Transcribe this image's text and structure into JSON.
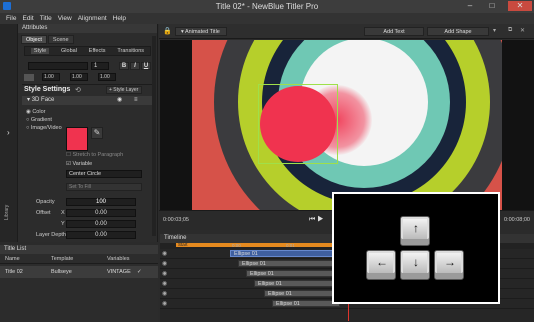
{
  "app": {
    "title": "Title 02* - NewBlue Titler Pro",
    "win_min": "–",
    "win_max": "□",
    "win_close": "✕"
  },
  "menu": [
    "File",
    "Edit",
    "Title",
    "View",
    "Alignment",
    "Help"
  ],
  "rail": {
    "label": "Library"
  },
  "attributes": {
    "header": "Attributes",
    "tabs": [
      "Object",
      "Scene"
    ],
    "subtabs": [
      "Style",
      "Global",
      "Effects",
      "Transitions"
    ],
    "font_size": "1",
    "bold": "B",
    "italic": "I",
    "underline": "U",
    "num1": "1.00",
    "num2": "1.00",
    "num3": "1.00",
    "style_settings": "Style Settings",
    "style_layer": "+ Style Layer",
    "face": "3D Face",
    "fill_types": [
      "Color",
      "Gradient",
      "Image/Video"
    ],
    "stretch": "Stretch to Paragraph",
    "variable": "Variable",
    "variable_value": "Center Circle",
    "set_to_fill": "Set To Fill",
    "opacity_label": "Opacity",
    "opacity_value": "100",
    "offset_label": "Offset",
    "x_label": "X",
    "x_value": "0.00",
    "y_label": "Y",
    "y_value": "0.00",
    "layer_depth_label": "Layer Depth",
    "layer_depth_value": "0.00",
    "swatch_color": "#f0334f"
  },
  "title_list": {
    "header": "Title List",
    "columns": [
      "Name",
      "Template",
      "Variables"
    ],
    "rows": [
      {
        "name": "Title 02",
        "template": "Bullseye",
        "variables": "VINTAGE"
      }
    ]
  },
  "toolbar": {
    "title_select": "Animated Title",
    "add_text": "Add Text",
    "add_shape": "Add Shape"
  },
  "canvas": {
    "bg": "#d65249",
    "rings": [
      "#3b3b3e",
      "#b6cf2b",
      "#18243a",
      "#6fc8b4",
      "#f4f4f4"
    ],
    "circle": "#f0334f"
  },
  "transport": {
    "time_left": "0:00:03;05",
    "time_right": "0:00:08;00"
  },
  "timeline": {
    "header": "Timeline",
    "start": "Start",
    "ticks": [
      "0:00",
      "0:01",
      "0:02"
    ],
    "clips": [
      "Ellipse 01",
      "Ellipse 01",
      "Ellipse 01",
      "Ellipse 01",
      "Ellipse 01",
      "Ellipse 01"
    ]
  },
  "overlay": {
    "keys": [
      "↑",
      "←",
      "↓",
      "→"
    ]
  }
}
